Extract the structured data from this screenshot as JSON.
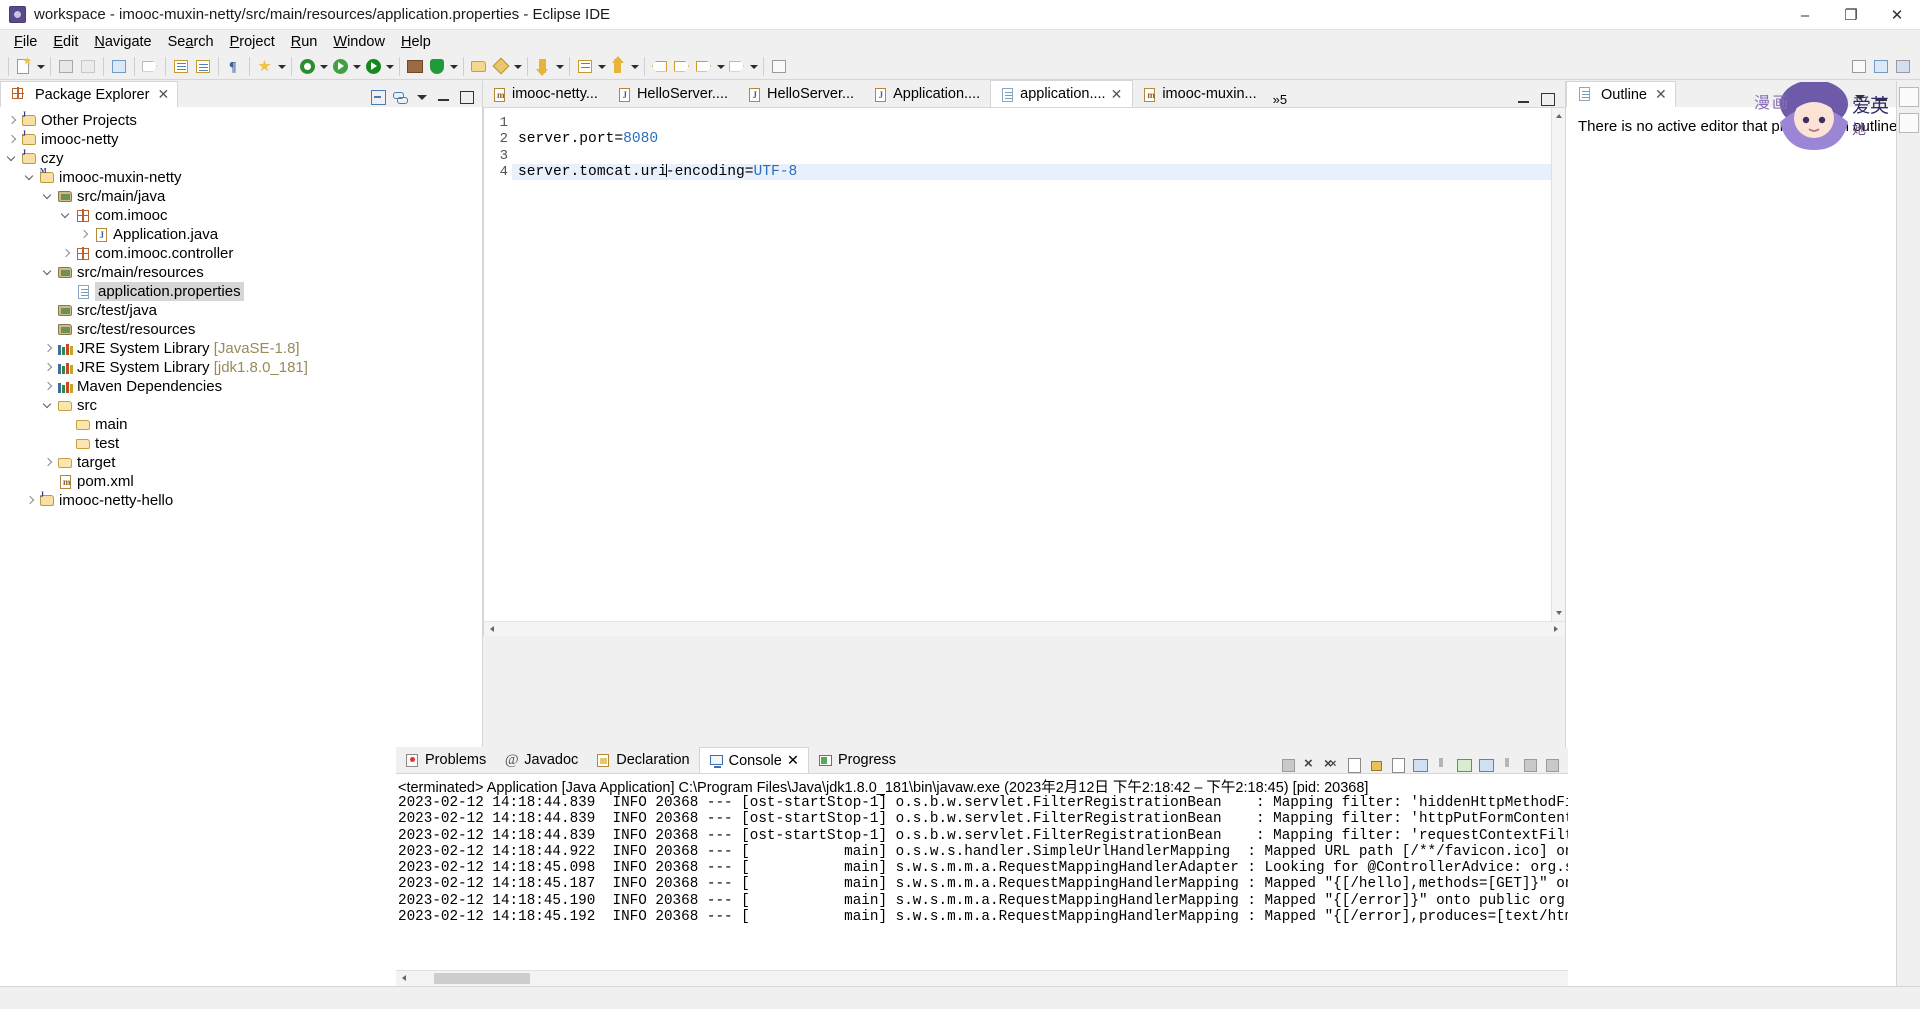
{
  "window": {
    "title": "workspace - imooc-muxin-netty/src/main/resources/application.properties - Eclipse IDE",
    "app_icon": "eclipse-icon",
    "minimize": "–",
    "maximize": "❐",
    "close": "✕"
  },
  "menu": [
    {
      "label": "File"
    },
    {
      "label": "Edit"
    },
    {
      "label": "Navigate"
    },
    {
      "label": "Search"
    },
    {
      "label": "Project"
    },
    {
      "label": "Run"
    },
    {
      "label": "Window"
    },
    {
      "label": "Help"
    }
  ],
  "explorer": {
    "tab_label": "Package Explorer",
    "close_glyph": "✕",
    "tree": [
      {
        "label": "Other Projects",
        "indent": 0,
        "twist": "right",
        "icon": "project-icon",
        "selected": false
      },
      {
        "label": "imooc-netty",
        "indent": 0,
        "twist": "right",
        "icon": "project-icon",
        "selected": false
      },
      {
        "label": "czy",
        "indent": 0,
        "twist": "down",
        "icon": "project-icon",
        "selected": false
      },
      {
        "label": "imooc-muxin-netty",
        "indent": 1,
        "twist": "down",
        "icon": "maven-project-icon",
        "selected": false
      },
      {
        "label": "src/main/java",
        "indent": 2,
        "twist": "down",
        "icon": "source-folder-icon",
        "selected": false
      },
      {
        "label": "com.imooc",
        "indent": 3,
        "twist": "down",
        "icon": "package-icon",
        "selected": false
      },
      {
        "label": "Application.java",
        "indent": 4,
        "twist": "right",
        "icon": "java-file-icon",
        "selected": false
      },
      {
        "label": "com.imooc.controller",
        "indent": 3,
        "twist": "right",
        "icon": "package-icon",
        "selected": false
      },
      {
        "label": "src/main/resources",
        "indent": 2,
        "twist": "down",
        "icon": "source-folder-icon",
        "selected": false
      },
      {
        "label": "application.properties",
        "indent": 3,
        "twist": "none",
        "icon": "properties-file-icon",
        "selected": true
      },
      {
        "label": "src/test/java",
        "indent": 2,
        "twist": "none",
        "icon": "source-folder-icon",
        "selected": false
      },
      {
        "label": "src/test/resources",
        "indent": 2,
        "twist": "none",
        "icon": "source-folder-icon",
        "selected": false
      },
      {
        "label": "JRE System Library ",
        "suffix": "[JavaSE-1.8]",
        "indent": 2,
        "twist": "right",
        "icon": "library-icon",
        "selected": false
      },
      {
        "label": "JRE System Library ",
        "suffix": "[jdk1.8.0_181]",
        "indent": 2,
        "twist": "right",
        "icon": "library-icon",
        "selected": false
      },
      {
        "label": "Maven Dependencies",
        "indent": 2,
        "twist": "right",
        "icon": "library-icon",
        "selected": false
      },
      {
        "label": "src",
        "indent": 2,
        "twist": "down",
        "icon": "folder-icon",
        "selected": false
      },
      {
        "label": "main",
        "indent": 3,
        "twist": "none",
        "icon": "folder-icon",
        "selected": false
      },
      {
        "label": "test",
        "indent": 3,
        "twist": "none",
        "icon": "folder-icon",
        "selected": false
      },
      {
        "label": "target",
        "indent": 2,
        "twist": "right",
        "icon": "folder-icon",
        "selected": false
      },
      {
        "label": "pom.xml",
        "indent": 2,
        "twist": "none",
        "icon": "xml-file-icon",
        "selected": false
      },
      {
        "label": "imooc-netty-hello",
        "indent": 1,
        "twist": "right",
        "icon": "project-icon",
        "selected": false
      }
    ]
  },
  "editor": {
    "tabs": [
      {
        "label": "imooc-netty...",
        "icon": "xml-file-icon",
        "active": false,
        "closable": false
      },
      {
        "label": "HelloServer....",
        "icon": "java-file-icon",
        "active": false,
        "closable": false
      },
      {
        "label": "HelloServer...",
        "icon": "java-file-icon",
        "active": false,
        "closable": false
      },
      {
        "label": "Application....",
        "icon": "java-file-icon",
        "active": false,
        "closable": false
      },
      {
        "label": "application....",
        "icon": "properties-file-icon",
        "active": true,
        "closable": true
      },
      {
        "label": "imooc-muxin...",
        "icon": "xml-file-icon",
        "active": false,
        "closable": false
      }
    ],
    "close_glyph": "✕",
    "overflow_label": "»5",
    "lines": [
      {
        "no": "1",
        "text": "",
        "highlight": false
      },
      {
        "no": "2",
        "key": "server.port=",
        "value": "8080",
        "highlight": false
      },
      {
        "no": "3",
        "text": "",
        "highlight": false
      },
      {
        "no": "4",
        "key": "server.tomcat.uri-encoding=",
        "value": "UTF-8",
        "highlight": true,
        "caret_after": "server.tomcat.uri"
      }
    ]
  },
  "outline": {
    "tab_label": "Outline",
    "close_glyph": "✕",
    "message": "There is no active editor that provides an outline."
  },
  "bottom": {
    "tabs": [
      {
        "label": "Problems",
        "icon": "problems-icon",
        "active": false,
        "closable": false
      },
      {
        "label": "Javadoc",
        "icon": "javadoc-icon",
        "active": false,
        "closable": false
      },
      {
        "label": "Declaration",
        "icon": "declaration-icon",
        "active": false,
        "closable": false
      },
      {
        "label": "Console",
        "icon": "console-icon",
        "active": true,
        "closable": true
      },
      {
        "label": "Progress",
        "icon": "progress-icon",
        "active": false,
        "closable": false
      }
    ],
    "close_glyph": "✕",
    "console_header": "<terminated> Application [Java Application] C:\\Program Files\\Java\\jdk1.8.0_181\\bin\\javaw.exe  (2023年2月12日 下午2:18:42 – 下午2:18:45) [pid: 20368]",
    "console_lines": [
      "2023-02-12 14:18:44.839  INFO 20368 --- [ost-startStop-1] o.s.b.w.servlet.FilterRegistrationBean    : Mapping filter: 'hiddenHttpMethodFilter' to: [/*]",
      "2023-02-12 14:18:44.839  INFO 20368 --- [ost-startStop-1] o.s.b.w.servlet.FilterRegistrationBean    : Mapping filter: 'httpPutFormContentFilter' to: [/*]",
      "2023-02-12 14:18:44.839  INFO 20368 --- [ost-startStop-1] o.s.b.w.servlet.FilterRegistrationBean    : Mapping filter: 'requestContextFilter' to: [/*]",
      "2023-02-12 14:18:44.922  INFO 20368 --- [           main] o.s.w.s.handler.SimpleUrlHandlerMapping  : Mapped URL path [/**/favicon.ico] onto handler of type [",
      "2023-02-12 14:18:45.098  INFO 20368 --- [           main] s.w.s.m.m.a.RequestMappingHandlerAdapter : Looking for @ControllerAdvice: org.springframework.boot.",
      "2023-02-12 14:18:45.187  INFO 20368 --- [           main] s.w.s.m.m.a.RequestMappingHandlerMapping : Mapped \"{[/hello],methods=[GET]}\" onto public java.lang.",
      "2023-02-12 14:18:45.190  INFO 20368 --- [           main] s.w.s.m.m.a.RequestMappingHandlerMapping : Mapped \"{[/error]}\" onto public org.springframework.http",
      "2023-02-12 14:18:45.192  INFO 20368 --- [           main] s.w.s.m.m.a.RequestMappingHandlerMapping : Mapped \"{[/error],produces=[text/html]}\" onto public org"
    ]
  },
  "colors": {
    "accent_blue": "#2a6fbb",
    "selection": "#d6d6d6",
    "line_highlight": "#e8f0fb",
    "chrome": "#f0f0f0"
  }
}
